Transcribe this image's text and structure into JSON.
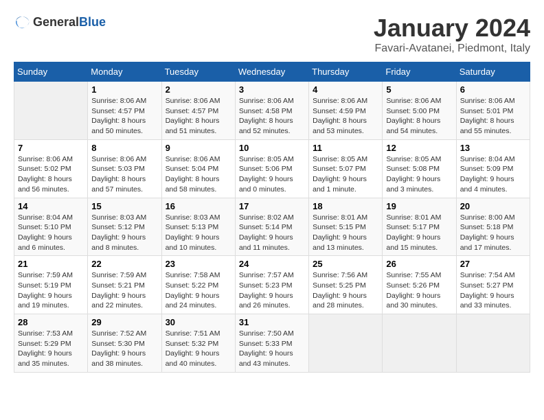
{
  "header": {
    "logo_general": "General",
    "logo_blue": "Blue",
    "title": "January 2024",
    "location": "Favari-Avatanei, Piedmont, Italy"
  },
  "days_of_week": [
    "Sunday",
    "Monday",
    "Tuesday",
    "Wednesday",
    "Thursday",
    "Friday",
    "Saturday"
  ],
  "weeks": [
    [
      {
        "day": "",
        "empty": true
      },
      {
        "day": "1",
        "sunrise": "Sunrise: 8:06 AM",
        "sunset": "Sunset: 4:57 PM",
        "daylight": "Daylight: 8 hours and 50 minutes."
      },
      {
        "day": "2",
        "sunrise": "Sunrise: 8:06 AM",
        "sunset": "Sunset: 4:57 PM",
        "daylight": "Daylight: 8 hours and 51 minutes."
      },
      {
        "day": "3",
        "sunrise": "Sunrise: 8:06 AM",
        "sunset": "Sunset: 4:58 PM",
        "daylight": "Daylight: 8 hours and 52 minutes."
      },
      {
        "day": "4",
        "sunrise": "Sunrise: 8:06 AM",
        "sunset": "Sunset: 4:59 PM",
        "daylight": "Daylight: 8 hours and 53 minutes."
      },
      {
        "day": "5",
        "sunrise": "Sunrise: 8:06 AM",
        "sunset": "Sunset: 5:00 PM",
        "daylight": "Daylight: 8 hours and 54 minutes."
      },
      {
        "day": "6",
        "sunrise": "Sunrise: 8:06 AM",
        "sunset": "Sunset: 5:01 PM",
        "daylight": "Daylight: 8 hours and 55 minutes."
      }
    ],
    [
      {
        "day": "7",
        "sunrise": "Sunrise: 8:06 AM",
        "sunset": "Sunset: 5:02 PM",
        "daylight": "Daylight: 8 hours and 56 minutes."
      },
      {
        "day": "8",
        "sunrise": "Sunrise: 8:06 AM",
        "sunset": "Sunset: 5:03 PM",
        "daylight": "Daylight: 8 hours and 57 minutes."
      },
      {
        "day": "9",
        "sunrise": "Sunrise: 8:06 AM",
        "sunset": "Sunset: 5:04 PM",
        "daylight": "Daylight: 8 hours and 58 minutes."
      },
      {
        "day": "10",
        "sunrise": "Sunrise: 8:05 AM",
        "sunset": "Sunset: 5:06 PM",
        "daylight": "Daylight: 9 hours and 0 minutes."
      },
      {
        "day": "11",
        "sunrise": "Sunrise: 8:05 AM",
        "sunset": "Sunset: 5:07 PM",
        "daylight": "Daylight: 9 hours and 1 minute."
      },
      {
        "day": "12",
        "sunrise": "Sunrise: 8:05 AM",
        "sunset": "Sunset: 5:08 PM",
        "daylight": "Daylight: 9 hours and 3 minutes."
      },
      {
        "day": "13",
        "sunrise": "Sunrise: 8:04 AM",
        "sunset": "Sunset: 5:09 PM",
        "daylight": "Daylight: 9 hours and 4 minutes."
      }
    ],
    [
      {
        "day": "14",
        "sunrise": "Sunrise: 8:04 AM",
        "sunset": "Sunset: 5:10 PM",
        "daylight": "Daylight: 9 hours and 6 minutes."
      },
      {
        "day": "15",
        "sunrise": "Sunrise: 8:03 AM",
        "sunset": "Sunset: 5:12 PM",
        "daylight": "Daylight: 9 hours and 8 minutes."
      },
      {
        "day": "16",
        "sunrise": "Sunrise: 8:03 AM",
        "sunset": "Sunset: 5:13 PM",
        "daylight": "Daylight: 9 hours and 10 minutes."
      },
      {
        "day": "17",
        "sunrise": "Sunrise: 8:02 AM",
        "sunset": "Sunset: 5:14 PM",
        "daylight": "Daylight: 9 hours and 11 minutes."
      },
      {
        "day": "18",
        "sunrise": "Sunrise: 8:01 AM",
        "sunset": "Sunset: 5:15 PM",
        "daylight": "Daylight: 9 hours and 13 minutes."
      },
      {
        "day": "19",
        "sunrise": "Sunrise: 8:01 AM",
        "sunset": "Sunset: 5:17 PM",
        "daylight": "Daylight: 9 hours and 15 minutes."
      },
      {
        "day": "20",
        "sunrise": "Sunrise: 8:00 AM",
        "sunset": "Sunset: 5:18 PM",
        "daylight": "Daylight: 9 hours and 17 minutes."
      }
    ],
    [
      {
        "day": "21",
        "sunrise": "Sunrise: 7:59 AM",
        "sunset": "Sunset: 5:19 PM",
        "daylight": "Daylight: 9 hours and 19 minutes."
      },
      {
        "day": "22",
        "sunrise": "Sunrise: 7:59 AM",
        "sunset": "Sunset: 5:21 PM",
        "daylight": "Daylight: 9 hours and 22 minutes."
      },
      {
        "day": "23",
        "sunrise": "Sunrise: 7:58 AM",
        "sunset": "Sunset: 5:22 PM",
        "daylight": "Daylight: 9 hours and 24 minutes."
      },
      {
        "day": "24",
        "sunrise": "Sunrise: 7:57 AM",
        "sunset": "Sunset: 5:23 PM",
        "daylight": "Daylight: 9 hours and 26 minutes."
      },
      {
        "day": "25",
        "sunrise": "Sunrise: 7:56 AM",
        "sunset": "Sunset: 5:25 PM",
        "daylight": "Daylight: 9 hours and 28 minutes."
      },
      {
        "day": "26",
        "sunrise": "Sunrise: 7:55 AM",
        "sunset": "Sunset: 5:26 PM",
        "daylight": "Daylight: 9 hours and 30 minutes."
      },
      {
        "day": "27",
        "sunrise": "Sunrise: 7:54 AM",
        "sunset": "Sunset: 5:27 PM",
        "daylight": "Daylight: 9 hours and 33 minutes."
      }
    ],
    [
      {
        "day": "28",
        "sunrise": "Sunrise: 7:53 AM",
        "sunset": "Sunset: 5:29 PM",
        "daylight": "Daylight: 9 hours and 35 minutes."
      },
      {
        "day": "29",
        "sunrise": "Sunrise: 7:52 AM",
        "sunset": "Sunset: 5:30 PM",
        "daylight": "Daylight: 9 hours and 38 minutes."
      },
      {
        "day": "30",
        "sunrise": "Sunrise: 7:51 AM",
        "sunset": "Sunset: 5:32 PM",
        "daylight": "Daylight: 9 hours and 40 minutes."
      },
      {
        "day": "31",
        "sunrise": "Sunrise: 7:50 AM",
        "sunset": "Sunset: 5:33 PM",
        "daylight": "Daylight: 9 hours and 43 minutes."
      },
      {
        "day": "",
        "empty": true
      },
      {
        "day": "",
        "empty": true
      },
      {
        "day": "",
        "empty": true
      }
    ]
  ]
}
